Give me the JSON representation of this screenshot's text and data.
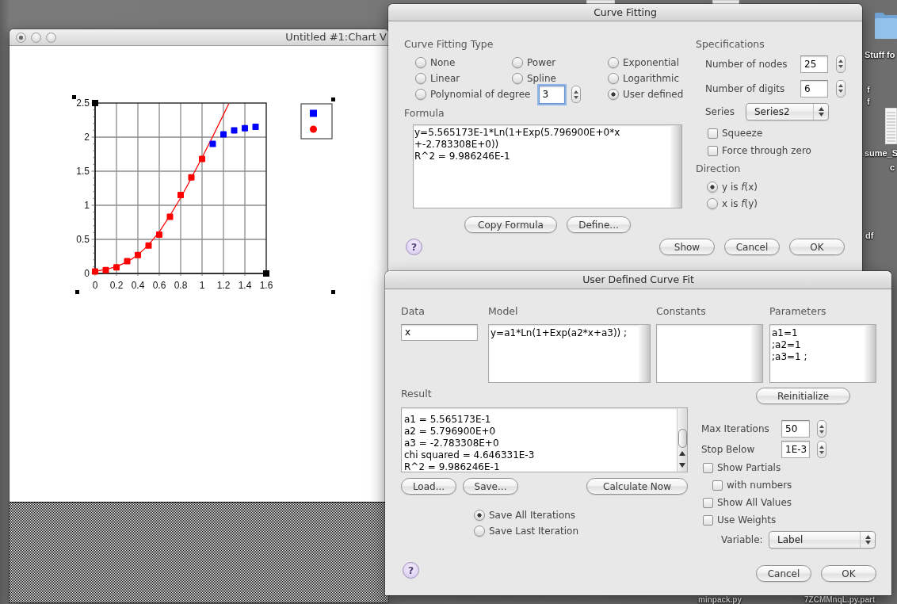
{
  "desktop_items": [
    {
      "kind": "document"
    },
    {
      "kind": "document"
    },
    {
      "kind": "folder",
      "label_lines": [
        "Stuff fo"
      ]
    },
    {
      "kind": "text",
      "label_lines": [
        "f",
        "f"
      ]
    },
    {
      "kind": "document",
      "label_lines": [
        "sume_S",
        "c"
      ]
    },
    {
      "kind": "text",
      "label_lines": [
        "df"
      ]
    },
    {
      "kind": "text",
      "label_lines": [
        "minpack.py"
      ]
    },
    {
      "kind": "text",
      "label_lines": [
        "7ZCMMnqL.py.part"
      ]
    }
  ],
  "chart_window": {
    "title": "Untitled #1:Chart V",
    "unsaved": true,
    "chart_data": {
      "type": "scatter",
      "grid": true,
      "x": [
        0,
        0.1,
        0.2,
        0.3,
        0.4,
        0.5,
        0.6,
        0.7,
        0.8,
        0.9,
        1,
        1.1,
        1.2,
        1.25,
        1.3,
        1.4,
        1.5
      ],
      "xlim": [
        0,
        1.6
      ],
      "ylim": [
        0,
        2.5
      ],
      "xticks": [
        0,
        0.2,
        0.4,
        0.6,
        0.8,
        1,
        1.2,
        1.4,
        1.6
      ],
      "yticks": [
        0,
        0.5,
        1,
        1.5,
        2,
        2.5
      ],
      "series": [
        {
          "color": "#0000ff",
          "values": [
            null,
            null,
            null,
            null,
            null,
            null,
            null,
            null,
            null,
            null,
            null,
            1.9,
            2.04,
            null,
            2.1,
            2.13,
            2.15
          ]
        },
        {
          "color": "#ff0000",
          "values": [
            0.03,
            0.05,
            0.09,
            0.18,
            0.27,
            0.41,
            0.57,
            0.83,
            1.15,
            1.41,
            1.68,
            null,
            null,
            null,
            null,
            null,
            null
          ]
        },
        {
          "color": "#ff0000",
          "type": "line",
          "values": [
            0.03,
            0.06,
            0.1,
            0.17,
            0.27,
            0.42,
            0.61,
            0.85,
            1.11,
            1.4,
            1.7,
            2.01,
            2.33,
            2.49,
            null,
            null,
            null
          ]
        }
      ]
    }
  },
  "curve_fitting": {
    "title": "Curve Fitting",
    "type_heading": "Curve Fitting Type",
    "fit_types": [
      {
        "label": "None",
        "selected": false
      },
      {
        "label": "Power",
        "selected": false
      },
      {
        "label": "Exponential",
        "selected": false
      },
      {
        "label": "Linear",
        "selected": false
      },
      {
        "label": "Spline",
        "selected": false
      },
      {
        "label": "Logarithmic",
        "selected": false
      },
      {
        "label": "Polynomial of degree",
        "selected": false,
        "degree": {
          "value": "3",
          "focused": true
        }
      },
      {
        "label": "User defined",
        "selected": true
      }
    ],
    "formula_heading": "Formula",
    "formula_lines": [
      "y=5.565173E-1*Ln(1+Exp(5.796900E+0*x",
      "+-2.783308E+0))",
      "R^2 = 9.986246E-1"
    ],
    "formula_buttons": [
      "Copy Formula",
      "Define..."
    ],
    "spec_heading": "Specifications",
    "spec_fields": [
      {
        "label": "Number of nodes",
        "value": "25"
      },
      {
        "label": "Number of digits",
        "value": "6"
      }
    ],
    "series": {
      "label": "Series",
      "value": "Series2"
    },
    "options": [
      {
        "label": "Squeeze",
        "checked": false
      },
      {
        "label": "Force through zero",
        "checked": false
      }
    ],
    "direction_heading": "Direction",
    "directions": [
      {
        "label": "y is *f*(x)",
        "selected": true
      },
      {
        "label": "x is *f*(y)",
        "selected": false
      }
    ],
    "help": "?",
    "buttons": [
      "Show",
      "Cancel",
      "OK"
    ]
  },
  "user_fit": {
    "title": "User Defined Curve Fit",
    "data": {
      "label": "Data",
      "value": "x"
    },
    "model": {
      "label": "Model",
      "lines": [
        "y=a1*Ln(1+Exp(a2*x+a3)) ;"
      ]
    },
    "constants": {
      "label": "Constants"
    },
    "parameters": {
      "label": "Parameters",
      "lines": [
        "a1=1",
        ";a2=1",
        ";a3=1 ;"
      ]
    },
    "reinitialize": "Reinitialize",
    "result": {
      "label": "Result",
      "lines": [
        "a1 = 5.565173E-1",
        "a2 = 5.796900E+0",
        "a3 = -2.783308E+0",
        "chi squared = 4.646331E-3",
        "R^2 = 9.986246E-1"
      ]
    },
    "result_buttons": [
      "Load...",
      "Save...",
      "Calculate Now"
    ],
    "save_modes": [
      {
        "label": "Save All Iterations",
        "selected": true
      },
      {
        "label": "Save Last Iteration",
        "selected": false
      }
    ],
    "help": "?",
    "limits": [
      {
        "label": "Max Iterations",
        "value": "50"
      },
      {
        "label": "Stop Below",
        "value": "1E-3"
      }
    ],
    "options": [
      {
        "label": "Show Partials",
        "checked": false,
        "children": [
          {
            "label": "with numbers",
            "checked": false
          }
        ]
      },
      {
        "label": "Show All Values",
        "checked": false
      },
      {
        "label": "Use Weights",
        "checked": false
      }
    ],
    "variable": {
      "label": "Variable:",
      "value": "Label"
    },
    "buttons": [
      "Cancel",
      "OK"
    ]
  }
}
